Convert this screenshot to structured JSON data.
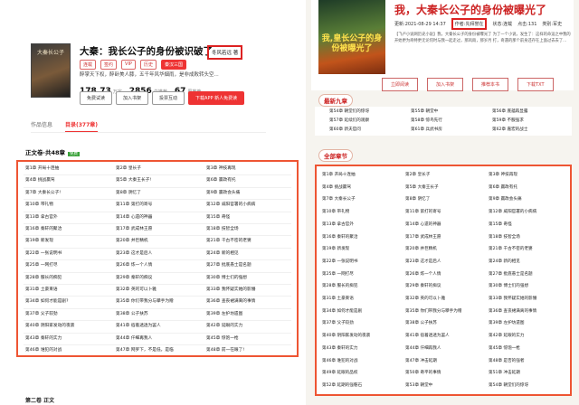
{
  "left": {
    "cover_text": "大秦长公子",
    "title": "大秦：我长公子的身份被识破了",
    "author": "冬风若远 著",
    "tags": [
      "连载",
      "签约",
      "VIP",
      "历史",
      "秦汉三国"
    ],
    "desc": "醉掌天下权，醉卧美人膝，五千年风华烟雨，是非成败转头空...",
    "stats": [
      {
        "num": "178.73",
        "unit": "万字"
      },
      {
        "num": "2856",
        "unit": "总推荐"
      },
      {
        "num": "67",
        "unit": "周推荐"
      }
    ],
    "buttons": [
      "免费试读",
      "加入书架",
      "投票互动",
      "下载APP 新人免费读"
    ],
    "tabs": [
      "作品信息",
      "目录(377章)"
    ],
    "volume": "正文卷·共48章",
    "volume_badge": "免费",
    "chapters": [
      "第1章 开局十连抽",
      "第2章 皇长子",
      "第3章 神技再现",
      "第4章 挑战赢驾",
      "第5章 大秦王长子!",
      "第6章 赢政有托",
      "第7章 大秦长公子!",
      "第8章 阴忆了",
      "第9章 赢政会头痛",
      "第10章 带礼物",
      "第11章 第打的寄号",
      "第12章 威阳官署的小病病",
      "第13章 拿古官外",
      "第14章 心遗的神器",
      "第15章 奇怪",
      "第16章 秦轩的聚洽",
      "第17章 武成林王愿",
      "第18章 技智全场",
      "第19章 新发现",
      "第20章 并巨精机",
      "第21章 千古不密的老婆",
      "第22章 一张说明书",
      "第23章 这才是后人",
      "第24章 新的相见",
      "第25章 一网打尽",
      "第26章 炼一个人情",
      "第27章 批底愚士是名题",
      "第28章 服长的痴犯",
      "第29章 秦轩的痴议",
      "第30章 博士们的强想",
      "第31章 土豪束语",
      "第32章 英的可以卜雅",
      "第33章 我怀疑实她的影懵",
      "第34章 如何才能是剧?",
      "第35章 你们带我分与攀手为赠",
      "第36章 查丧裙满离的事情",
      "第37章 父子较劲",
      "第38章 公子扶苏",
      "第39章 左护坊遗图",
      "第40章 阴阳家发动的夜袭",
      "第41章 宿着透透为罢人",
      "第42章 延眼的实力",
      "第43章 秦轩的实力",
      "第44章 仟细再我人",
      "第45章 惊饱一枪",
      "第46章 谁犯的对战",
      "第47章 网罗下，不是低，是临",
      "第48章 前一在眼了!"
    ],
    "footer": "第二卷 正文"
  },
  "right": {
    "cover_text": "我,皇长公子的身份被曝光了",
    "title": "我，大秦长公子的身份被曝光了",
    "update_label": "更新:",
    "update_time": "2021-08-29 14:37",
    "author_label": "作者:",
    "author": "先拜誉在",
    "status_label": "状态:",
    "status": "连载",
    "clicks_label": "点击:",
    "clicks": "131",
    "category_label": "类别:",
    "category": "军史",
    "intro": "【飞卢小说网历史小说】我，大秦长公子的身份被曝光了 为了一个小说，发生了：这样的命运之中我的开始更为奇特更无论何时与我一起走过，那风雨，那岁月 打，奇遇的那个前身还存在上面过去去了...",
    "buttons": [
      "立即阅读",
      "加入书架",
      "推荐本书",
      "下载TXT"
    ],
    "latest_label": "最新九章",
    "latest": [
      "第54章 朝堂们的惊讶",
      "第55章 朝堂中",
      "第56章 底蕴再显露",
      "第57章 延续们的观察",
      "第58章 惊鸟先行",
      "第59章 不服强求",
      "第60章 新夫官问",
      "第61章 兵武书房",
      "第62章 嘉宏的战士"
    ],
    "all_label": "全部章节",
    "chapters": [
      "第1章 开局十连抽",
      "第2章 皇长子",
      "第3章 神技再现",
      "第4章 挑战赢驾",
      "第5章 大秦王长子",
      "第6章 赢政有托",
      "第7章 大秦长公子",
      "第8章 阴忆了",
      "第9章 赢政会头痛",
      "第10章 带礼物",
      "第11章 第打的寄号",
      "第12章 威阳官署的小病病",
      "第13章 拿古官外",
      "第14章 心遗的神器",
      "第15章 奇怪",
      "第16章 秦轩的聚洽",
      "第17章 武成林王愿",
      "第18章 技智全场",
      "第19章 新发现",
      "第20章 并巨精机",
      "第21章 千古不密的老婆",
      "第22章 一张说明书",
      "第23章 这才是后人",
      "第24章 新的相见",
      "第25章 一网打尽",
      "第26章 炼一个人情",
      "第27章 批底愚士是名题",
      "第28章 服长的痴犯",
      "第29章 秦轩的痴议",
      "第30章 博士们的强想",
      "第31章 土豪束语",
      "第32章 英的可以卜雅",
      "第33章 我怀疑实她的影懵",
      "第34章 如何才能是剧",
      "第35章 你们带我分与攀手为赠",
      "第36章 查丧裙满离的事情",
      "第37章 父子较劲",
      "第38章 公子扶苏",
      "第39章 左护坊遗图",
      "第40章 阴阳家发动的夜袭",
      "第41章 宿着透透为罢人",
      "第42章 延眼的实力",
      "第43章 秦轩的实力",
      "第44章 仟细再我人",
      "第45章 惊饱一枪",
      "第46章 谁犯的对战",
      "第47章 冲击延期",
      "第48章 是否的强者",
      "第49章 延眼的品权",
      "第50章 奇平的事情",
      "第51章 冲击延期",
      "第52章 延期的强磐石",
      "第53章 朝堂中",
      "第54章 朝堂们的惊讶"
    ]
  },
  "colors": {
    "accent": "#e53322",
    "title_red": "#c22222"
  }
}
